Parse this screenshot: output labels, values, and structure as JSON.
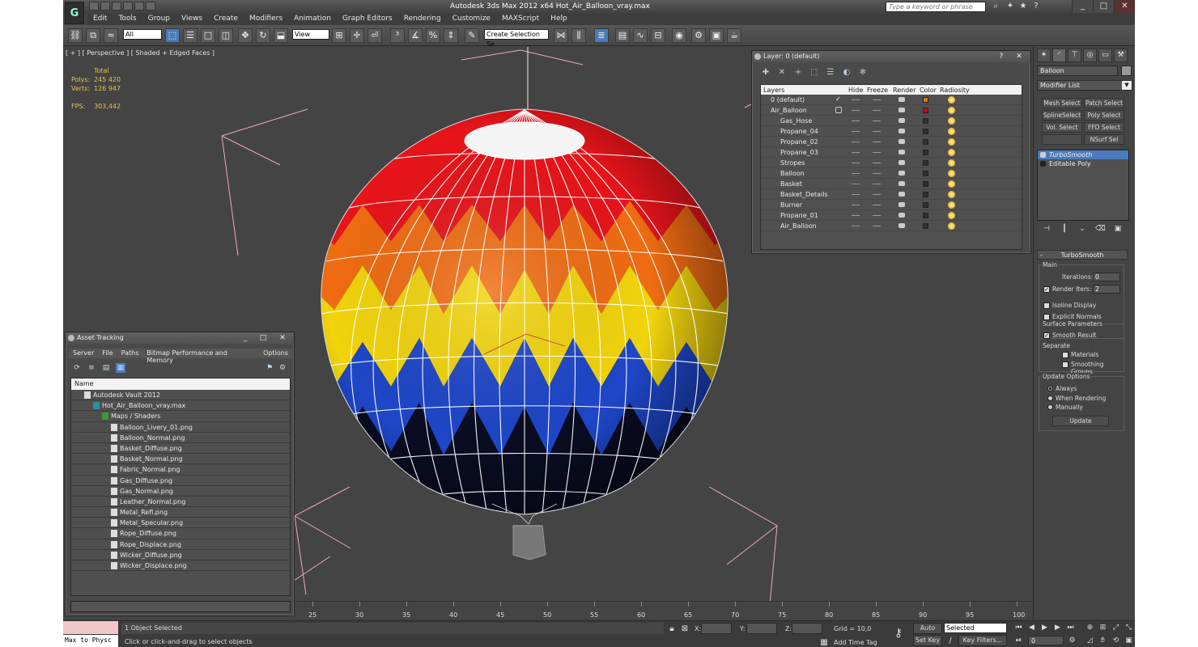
{
  "window": {
    "title": "Autodesk 3ds Max  2012 x64      Hot_Air_Balloon_vray.max",
    "search_placeholder": "Type a keyword or phrase",
    "controls": [
      "_",
      "□",
      "✕"
    ]
  },
  "menu": [
    "Edit",
    "Tools",
    "Group",
    "Views",
    "Create",
    "Modifiers",
    "Animation",
    "Graph Editors",
    "Rendering",
    "Customize",
    "MAXScript",
    "Help"
  ],
  "toolbar": {
    "selection_filter": "All",
    "reference_coord": "View",
    "named_selection": "Create Selection Se"
  },
  "viewport": {
    "label": "[ + ] [ Perspective ] [ Shaded + Edged Faces ]",
    "stats": {
      "total_label": "Total",
      "polys_label": "Polys:",
      "polys": "245 420",
      "verts_label": "Verts:",
      "verts": "126 947",
      "fps_label": "FPS:",
      "fps": "303,442"
    },
    "colors": {
      "red": "#e8141a",
      "orange": "#f06c12",
      "yellow": "#f2d40c",
      "blue": "#1e46c8",
      "dark": "#0a0c22",
      "bg": "#444444"
    }
  },
  "layer_dialog": {
    "title": "Layer: 0 (default)",
    "columns": [
      "Layers",
      "Hide",
      "Freeze",
      "Render",
      "Color",
      "Radiosity"
    ],
    "rows": [
      {
        "name": "0 (default)",
        "level": 0,
        "color": "#e07818",
        "current": true
      },
      {
        "name": "Air_Balloon",
        "level": 0,
        "color": "#c01010",
        "current": false
      },
      {
        "name": "Gas_Hose",
        "level": 1,
        "color": "#303030",
        "current": false
      },
      {
        "name": "Propane_04",
        "level": 1,
        "color": "#303030",
        "current": false
      },
      {
        "name": "Propane_02",
        "level": 1,
        "color": "#303030",
        "current": false
      },
      {
        "name": "Propane_03",
        "level": 1,
        "color": "#303030",
        "current": false
      },
      {
        "name": "Stropes",
        "level": 1,
        "color": "#303030",
        "current": false
      },
      {
        "name": "Balloon",
        "level": 1,
        "color": "#303030",
        "current": false
      },
      {
        "name": "Basket",
        "level": 1,
        "color": "#303030",
        "current": false
      },
      {
        "name": "Basket_Details",
        "level": 1,
        "color": "#303030",
        "current": false
      },
      {
        "name": "Burner",
        "level": 1,
        "color": "#303030",
        "current": false
      },
      {
        "name": "Propane_01",
        "level": 1,
        "color": "#303030",
        "current": false
      },
      {
        "name": "Air_Balloon",
        "level": 1,
        "color": "#303030",
        "current": false
      }
    ]
  },
  "asset_dialog": {
    "title": "Asset Tracking",
    "menu": [
      "Server",
      "File",
      "Paths",
      "Bitmap Performance and Memory",
      "Options"
    ],
    "column": "Name",
    "rows": [
      {
        "name": "Autodesk Vault 2012",
        "level": 0
      },
      {
        "name": "Hot_Air_Balloon_vray.max",
        "level": 1
      },
      {
        "name": "Maps / Shaders",
        "level": 2
      },
      {
        "name": "Balloon_Livery_01.png",
        "level": 3
      },
      {
        "name": "Balloon_Normal.png",
        "level": 3
      },
      {
        "name": "Basket_Diffuse.png",
        "level": 3
      },
      {
        "name": "Basket_Normal.png",
        "level": 3
      },
      {
        "name": "Fabric_Normal.png",
        "level": 3
      },
      {
        "name": "Gas_Diffuse.png",
        "level": 3
      },
      {
        "name": "Gas_Normal.png",
        "level": 3
      },
      {
        "name": "Leather_Normal.png",
        "level": 3
      },
      {
        "name": "Metal_Refl.png",
        "level": 3
      },
      {
        "name": "Metal_Specular.png",
        "level": 3
      },
      {
        "name": "Rope_Diffuse.png",
        "level": 3
      },
      {
        "name": "Rope_Displace.png",
        "level": 3
      },
      {
        "name": "Wicker_Diffuse.png",
        "level": 3
      },
      {
        "name": "Wicker_Displace.png",
        "level": 3
      }
    ]
  },
  "command_panel": {
    "object_name": "Balloon",
    "modifier_list": "Modifier List",
    "buttons": [
      "Mesh Select",
      "Patch Select",
      "SplineSelect",
      "Poly Select",
      "Vol. Select",
      "FFD Select",
      "",
      "NSurf Sel"
    ],
    "stack": [
      "TurboSmooth",
      "Editable Poly"
    ],
    "rollout": {
      "title": "TurboSmooth",
      "main": "Main",
      "iterations_label": "Iterations:",
      "iterations": "0",
      "render_iters_label": "Render Iters:",
      "render_iters": "2",
      "isoline": "Isoline Display",
      "explicit_normals": "Explicit Normals",
      "surface_params": "Surface Parameters",
      "smooth_result": "Smooth Result",
      "separate": "Separate",
      "materials": "Materials",
      "smoothing_groups": "Smoothing Groups",
      "update_options": "Update Options",
      "always": "Always",
      "when_rendering": "When Rendering",
      "manually": "Manually",
      "update": "Update"
    }
  },
  "timeline": {
    "labels": [
      "25",
      "30",
      "35",
      "40",
      "45",
      "50",
      "55",
      "60",
      "65",
      "70",
      "75",
      "80",
      "85",
      "90",
      "95",
      "100"
    ]
  },
  "status": {
    "maxscript": "Max to Physc",
    "selected": "1 Object Selected",
    "prompt": "Click or click-and-drag to select objects",
    "x": "X:",
    "y": "Y:",
    "z": "Z:",
    "grid": "Grid = 10,0",
    "add_time_tag": "Add Time Tag",
    "auto_key": "Auto Key",
    "key_mode": "Selected",
    "set_key": "Set Key",
    "key_filters": "Key Filters...",
    "frame": "0"
  }
}
